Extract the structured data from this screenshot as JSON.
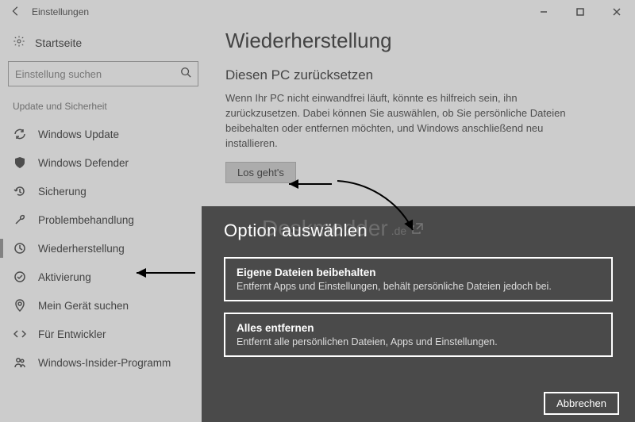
{
  "titlebar": {
    "title": "Einstellungen"
  },
  "sidebar": {
    "home": "Startseite",
    "search_placeholder": "Einstellung suchen",
    "section": "Update und Sicherheit",
    "items": [
      {
        "label": "Windows Update"
      },
      {
        "label": "Windows Defender"
      },
      {
        "label": "Sicherung"
      },
      {
        "label": "Problembehandlung"
      },
      {
        "label": "Wiederherstellung"
      },
      {
        "label": "Aktivierung"
      },
      {
        "label": "Mein Gerät suchen"
      },
      {
        "label": "Für Entwickler"
      },
      {
        "label": "Windows-Insider-Programm"
      }
    ]
  },
  "main": {
    "heading": "Wiederherstellung",
    "subheading": "Diesen PC zurücksetzen",
    "paragraph": "Wenn Ihr PC nicht einwandfrei läuft, könnte es hilfreich sein, ihn zurückzusetzen. Dabei können Sie auswählen, ob Sie persönliche Dateien beibehalten oder entfernen möchten, und Windows anschließend neu installieren.",
    "start_button": "Los geht's"
  },
  "modal": {
    "title": "Option auswählen",
    "options": [
      {
        "title": "Eigene Dateien beibehalten",
        "desc": "Entfernt Apps und Einstellungen, behält persönliche Dateien jedoch bei."
      },
      {
        "title": "Alles entfernen",
        "desc": "Entfernt alle persönlichen Dateien, Apps und Einstellungen."
      }
    ],
    "cancel": "Abbrechen"
  },
  "watermark": {
    "text": "Deskmodder",
    "ext": ".de"
  }
}
